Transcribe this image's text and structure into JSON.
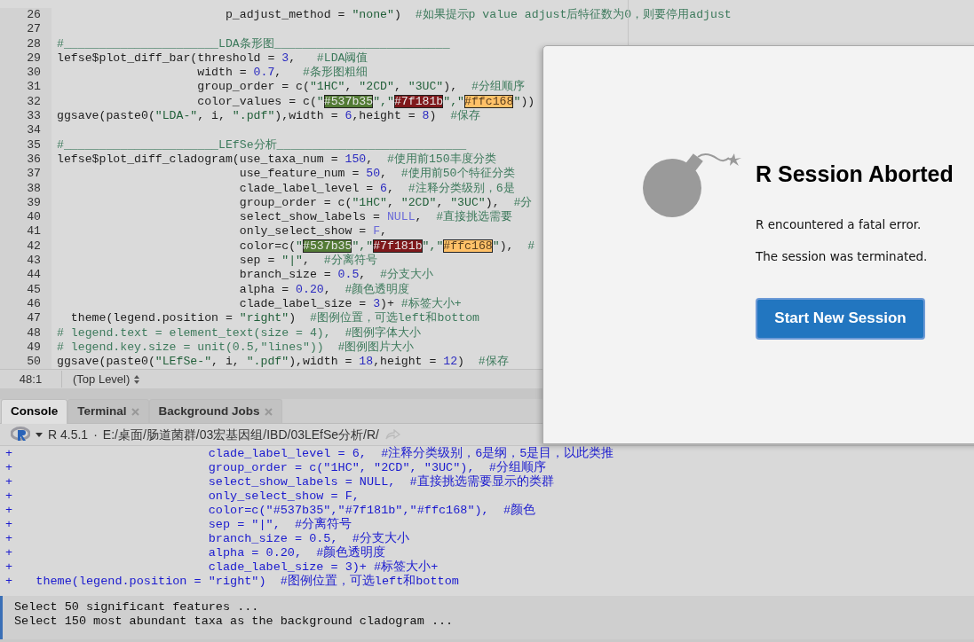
{
  "editor": {
    "lines": [
      {
        "number": "26",
        "tokens": [
          {
            "kind": "plain",
            "text": "                        p_adjust_method = "
          },
          {
            "kind": "string",
            "text": "\"none\""
          },
          {
            "kind": "plain",
            "text": ")  "
          },
          {
            "kind": "comment",
            "text": "#如果提示p value adjust后特征数为0，则要停用adjust"
          }
        ]
      },
      {
        "number": "27"
      },
      {
        "number": "28",
        "tokens": [
          {
            "kind": "comment",
            "text": "#______________________LDA条形图_________________________"
          }
        ]
      },
      {
        "number": "29",
        "tokens": [
          {
            "kind": "plain",
            "text": "lefse$plot_diff_bar(threshold = "
          },
          {
            "kind": "number",
            "text": "3"
          },
          {
            "kind": "plain",
            "text": ",   "
          },
          {
            "kind": "comment",
            "text": "#LDA阈值"
          }
        ]
      },
      {
        "number": "30",
        "tokens": [
          {
            "kind": "plain",
            "text": "                    width = "
          },
          {
            "kind": "number",
            "text": "0.7"
          },
          {
            "kind": "plain",
            "text": ",   "
          },
          {
            "kind": "comment",
            "text": "#条形图粗细"
          }
        ]
      },
      {
        "number": "31",
        "tokens": [
          {
            "kind": "plain",
            "text": "                    group_order = c("
          },
          {
            "kind": "string",
            "text": "\"1HC\""
          },
          {
            "kind": "plain",
            "text": ", "
          },
          {
            "kind": "string",
            "text": "\"2CD\""
          },
          {
            "kind": "plain",
            "text": ", "
          },
          {
            "kind": "string",
            "text": "\"3UC\""
          },
          {
            "kind": "plain",
            "text": "),  "
          },
          {
            "kind": "comment",
            "text": "#分组顺序"
          }
        ]
      },
      {
        "number": "32",
        "tokens": [
          {
            "kind": "plain",
            "text": "                    color_values = c("
          },
          {
            "kind": "string",
            "text": "\""
          },
          {
            "kind": "hex",
            "text": "#537b35",
            "color": "#537b35"
          },
          {
            "kind": "string",
            "text": "\",\""
          },
          {
            "kind": "hex",
            "text": "#7f181b",
            "color": "#7f181b"
          },
          {
            "kind": "string",
            "text": "\",\""
          },
          {
            "kind": "hex",
            "text": "#ffc168",
            "color": "#ffc168"
          },
          {
            "kind": "string",
            "text": "\""
          },
          {
            "kind": "plain",
            "text": "))"
          }
        ]
      },
      {
        "number": "33",
        "tokens": [
          {
            "kind": "plain",
            "text": "ggsave(paste0("
          },
          {
            "kind": "string",
            "text": "\"LDA-\""
          },
          {
            "kind": "plain",
            "text": ", i, "
          },
          {
            "kind": "string",
            "text": "\".pdf\""
          },
          {
            "kind": "plain",
            "text": "),width = "
          },
          {
            "kind": "number",
            "text": "6"
          },
          {
            "kind": "plain",
            "text": ",height = "
          },
          {
            "kind": "number",
            "text": "8"
          },
          {
            "kind": "plain",
            "text": ")  "
          },
          {
            "kind": "comment",
            "text": "#保存"
          }
        ]
      },
      {
        "number": "34"
      },
      {
        "number": "35",
        "tokens": [
          {
            "kind": "comment",
            "text": "#______________________LEfSe分析___________________________"
          }
        ]
      },
      {
        "number": "36",
        "tokens": [
          {
            "kind": "plain",
            "text": "lefse$plot_diff_cladogram(use_taxa_num = "
          },
          {
            "kind": "number",
            "text": "150"
          },
          {
            "kind": "plain",
            "text": ",  "
          },
          {
            "kind": "comment",
            "text": "#使用前150丰度分类"
          }
        ]
      },
      {
        "number": "37",
        "tokens": [
          {
            "kind": "plain",
            "text": "                          use_feature_num = "
          },
          {
            "kind": "number",
            "text": "50"
          },
          {
            "kind": "plain",
            "text": ",  "
          },
          {
            "kind": "comment",
            "text": "#使用前50个特征分类"
          }
        ]
      },
      {
        "number": "38",
        "tokens": [
          {
            "kind": "plain",
            "text": "                          clade_label_level = "
          },
          {
            "kind": "number",
            "text": "6"
          },
          {
            "kind": "plain",
            "text": ",  "
          },
          {
            "kind": "comment",
            "text": "#注释分类级别，6是"
          }
        ]
      },
      {
        "number": "39",
        "tokens": [
          {
            "kind": "plain",
            "text": "                          group_order = c("
          },
          {
            "kind": "string",
            "text": "\"1HC\""
          },
          {
            "kind": "plain",
            "text": ", "
          },
          {
            "kind": "string",
            "text": "\"2CD\""
          },
          {
            "kind": "plain",
            "text": ", "
          },
          {
            "kind": "string",
            "text": "\"3UC\""
          },
          {
            "kind": "plain",
            "text": "),  "
          },
          {
            "kind": "comment",
            "text": "#分"
          }
        ]
      },
      {
        "number": "40",
        "tokens": [
          {
            "kind": "plain",
            "text": "                          select_show_labels = "
          },
          {
            "kind": "keyword",
            "text": "NULL"
          },
          {
            "kind": "plain",
            "text": ",  "
          },
          {
            "kind": "comment",
            "text": "#直接挑选需要"
          }
        ]
      },
      {
        "number": "41",
        "tokens": [
          {
            "kind": "plain",
            "text": "                          only_select_show = "
          },
          {
            "kind": "keyword",
            "text": "F"
          },
          {
            "kind": "plain",
            "text": ","
          }
        ]
      },
      {
        "number": "42",
        "tokens": [
          {
            "kind": "plain",
            "text": "                          color=c("
          },
          {
            "kind": "string",
            "text": "\""
          },
          {
            "kind": "hex",
            "text": "#537b35",
            "color": "#537b35"
          },
          {
            "kind": "string",
            "text": "\",\""
          },
          {
            "kind": "hex",
            "text": "#7f181b",
            "color": "#7f181b"
          },
          {
            "kind": "string",
            "text": "\",\""
          },
          {
            "kind": "hex",
            "text": "#ffc168",
            "color": "#ffc168"
          },
          {
            "kind": "string",
            "text": "\""
          },
          {
            "kind": "plain",
            "text": "),  "
          },
          {
            "kind": "comment",
            "text": "#"
          }
        ]
      },
      {
        "number": "43",
        "tokens": [
          {
            "kind": "plain",
            "text": "                          sep = "
          },
          {
            "kind": "string",
            "text": "\"|\""
          },
          {
            "kind": "plain",
            "text": ",  "
          },
          {
            "kind": "comment",
            "text": "#分离符号"
          }
        ]
      },
      {
        "number": "44",
        "tokens": [
          {
            "kind": "plain",
            "text": "                          branch_size = "
          },
          {
            "kind": "number",
            "text": "0.5"
          },
          {
            "kind": "plain",
            "text": ",  "
          },
          {
            "kind": "comment",
            "text": "#分支大小"
          }
        ]
      },
      {
        "number": "45",
        "tokens": [
          {
            "kind": "plain",
            "text": "                          alpha = "
          },
          {
            "kind": "number",
            "text": "0.20"
          },
          {
            "kind": "plain",
            "text": ",  "
          },
          {
            "kind": "comment",
            "text": "#颜色透明度"
          }
        ]
      },
      {
        "number": "46",
        "tokens": [
          {
            "kind": "plain",
            "text": "                          clade_label_size = "
          },
          {
            "kind": "number",
            "text": "3"
          },
          {
            "kind": "plain",
            "text": ")+ "
          },
          {
            "kind": "comment",
            "text": "#标签大小+"
          }
        ]
      },
      {
        "number": "47",
        "tokens": [
          {
            "kind": "plain",
            "text": "  theme(legend.position = "
          },
          {
            "kind": "string",
            "text": "\"right\""
          },
          {
            "kind": "plain",
            "text": ")  "
          },
          {
            "kind": "comment",
            "text": "#图例位置，可选left和bottom"
          }
        ]
      },
      {
        "number": "48",
        "tokens": [
          {
            "kind": "comment",
            "text": "# legend.text = element_text(size = 4),  #图例字体大小"
          }
        ]
      },
      {
        "number": "49",
        "tokens": [
          {
            "kind": "comment",
            "text": "# legend.key.size = unit(0.5,\"lines\"))  #图例图片大小"
          }
        ]
      },
      {
        "number": "50",
        "tokens": [
          {
            "kind": "plain",
            "text": "ggsave(paste0("
          },
          {
            "kind": "string",
            "text": "\"LEfSe-\""
          },
          {
            "kind": "plain",
            "text": ", i, "
          },
          {
            "kind": "string",
            "text": "\".pdf\""
          },
          {
            "kind": "plain",
            "text": "),width = "
          },
          {
            "kind": "number",
            "text": "18"
          },
          {
            "kind": "plain",
            "text": ",height = "
          },
          {
            "kind": "number",
            "text": "12"
          },
          {
            "kind": "plain",
            "text": ")  "
          },
          {
            "kind": "comment",
            "text": "#保存"
          }
        ]
      }
    ],
    "status_bar": {
      "position": "48:1",
      "scope": "(Top Level)"
    }
  },
  "console": {
    "tabs": [
      {
        "label": "Console",
        "selected": true,
        "closable": false
      },
      {
        "label": "Terminal",
        "selected": false,
        "closable": true
      },
      {
        "label": "Background Jobs",
        "selected": false,
        "closable": true
      }
    ],
    "version": "R 4.5.1",
    "separator": "·",
    "path": "E:/桌面/肠道菌群/03宏基因组/IBD/03LEfSe分析/R/",
    "lines": [
      {
        "prompt": "+",
        "text": "                           clade_label_level = 6,  #注释分类级别，6是纲，5是目，以此类推"
      },
      {
        "prompt": "+",
        "text": "                           group_order = c(\"1HC\", \"2CD\", \"3UC\"),  #分组顺序"
      },
      {
        "prompt": "+",
        "text": "                           select_show_labels = NULL,  #直接挑选需要显示的类群"
      },
      {
        "prompt": "+",
        "text": "                           only_select_show = F,"
      },
      {
        "prompt": "+",
        "text": "                           color=c(\"#537b35\",\"#7f181b\",\"#ffc168\"),  #颜色"
      },
      {
        "prompt": "+",
        "text": "                           sep = \"|\",  #分离符号"
      },
      {
        "prompt": "+",
        "text": "                           branch_size = 0.5,  #分支大小"
      },
      {
        "prompt": "+",
        "text": "                           alpha = 0.20,  #颜色透明度"
      },
      {
        "prompt": "+",
        "text": "                           clade_label_size = 3)+ #标签大小+"
      },
      {
        "prompt": "+",
        "text": "   theme(legend.position = \"right\")  #图例位置，可选left和bottom"
      }
    ],
    "output": [
      "Select 50 significant features ...",
      "Select 150 most abundant taxa as the background cladogram ..."
    ]
  },
  "dialog": {
    "title": "R Session Aborted",
    "messages": [
      "R encountered a fatal error.",
      "The session was terminated."
    ],
    "button": "Start New Session"
  }
}
